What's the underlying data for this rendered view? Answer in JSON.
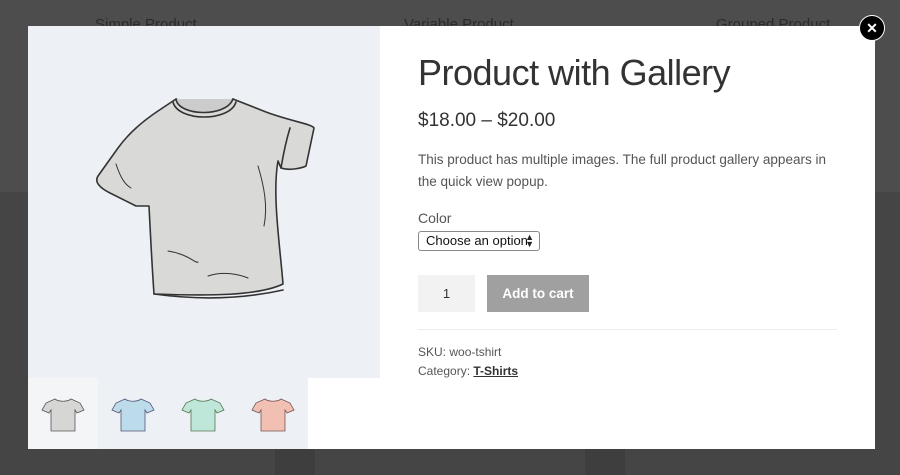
{
  "background": {
    "products": [
      "Simple Product",
      "Variable Product",
      "Grouped Product"
    ]
  },
  "product": {
    "title": "Product with Gallery",
    "price": "$18.00 – $20.00",
    "description": "This product has multiple images. The full product gallery appears in the quick view popup.",
    "color_label": "Color",
    "color_select": "Choose an option",
    "quantity": "1",
    "add_to_cart": "Add to cart",
    "sku_label": "SKU:",
    "sku": "woo-tshirt",
    "category_label": "Category:",
    "category": "T-Shirts"
  },
  "gallery": {
    "thumbnails": [
      {
        "name": "gray-tshirt",
        "color": "#d6d6d4"
      },
      {
        "name": "blue-tshirt",
        "color": "#bcdcec"
      },
      {
        "name": "mint-tshirt",
        "color": "#bfe7d9"
      },
      {
        "name": "pink-tshirt",
        "color": "#f2bfb3"
      }
    ]
  },
  "close_icon": "close-icon"
}
